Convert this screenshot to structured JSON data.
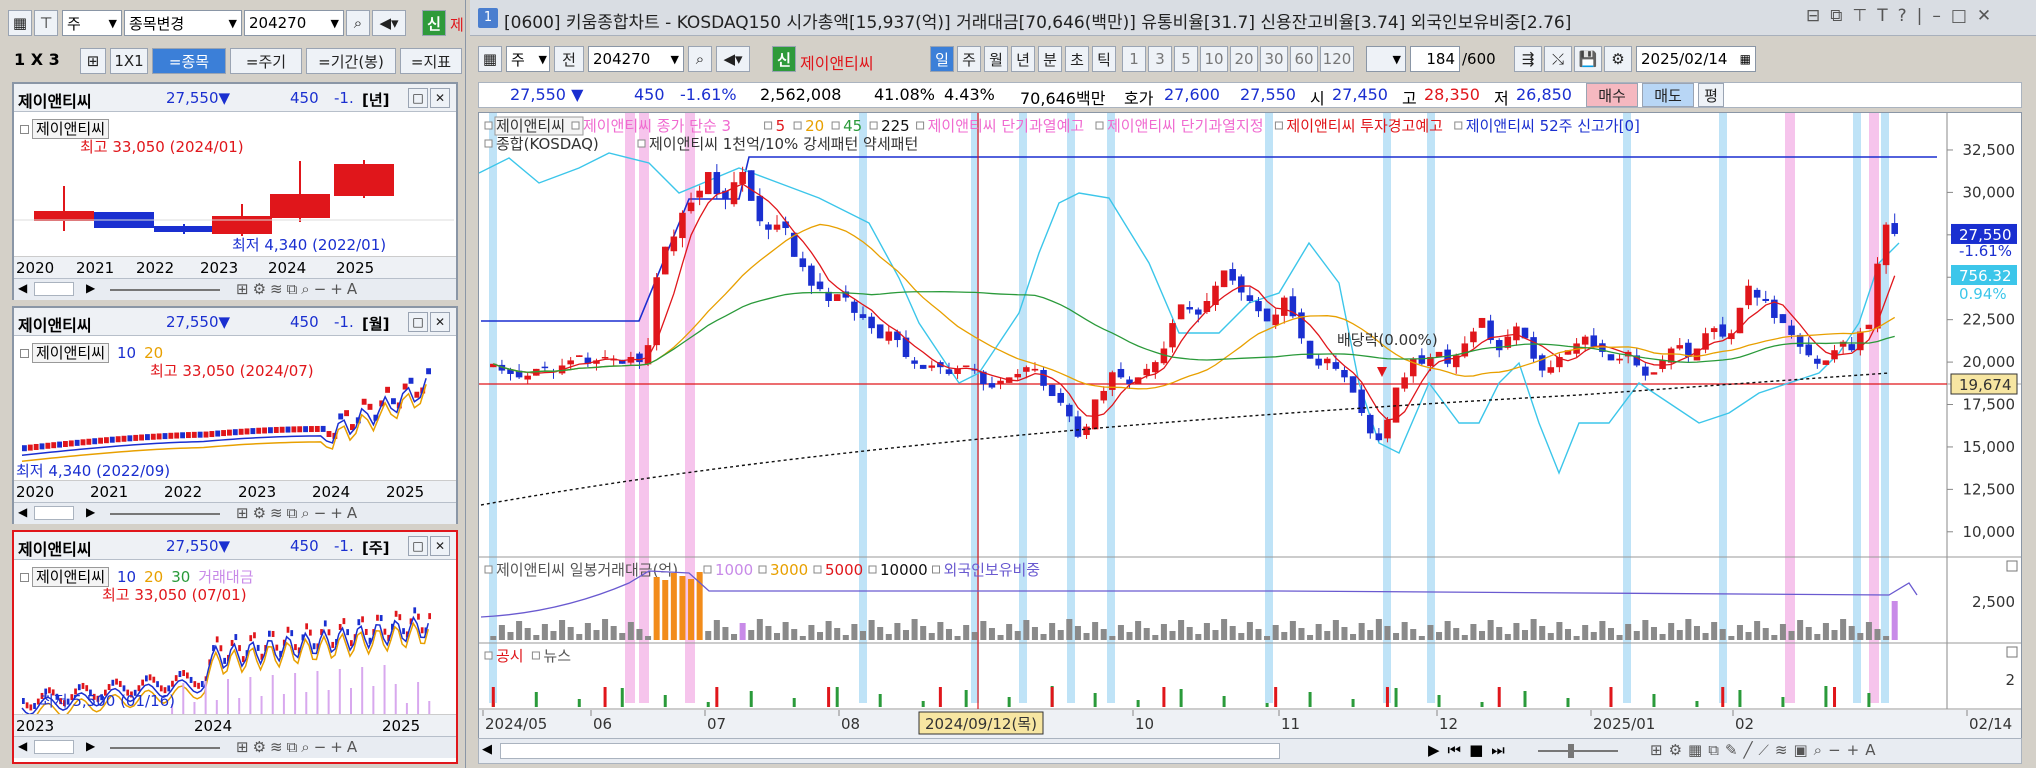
{
  "left_toolbar": {
    "stock_change": "종목변경",
    "code": "204270",
    "new_badge": "신",
    "new_name": "제",
    "prefix": "주"
  },
  "left_tabs": {
    "layout1": "1",
    "layout_x": "X",
    "layout3": "3",
    "one_by_one": "1X1",
    "stock": "=종목",
    "period": "=주기",
    "range": "=기간(봉)",
    "indicator": "=지표"
  },
  "mini_charts": [
    {
      "name": "제이앤티씨",
      "price": "27,550▼",
      "change": "450",
      "rate": "-1.",
      "period": "[년]",
      "chip": "제이앤티씨",
      "legend": [],
      "high_label": "최고 33,050 (2024/01)",
      "low_label": "최저 4,340 (2022/01)",
      "x_ticks": [
        "2020",
        "2021",
        "2022",
        "2023",
        "2024",
        "2025"
      ]
    },
    {
      "name": "제이앤티씨",
      "price": "27,550▼",
      "change": "450",
      "rate": "-1.",
      "period": "[월]",
      "chip": "제이앤티씨",
      "legend": [
        "10",
        "20"
      ],
      "high_label": "최고 33,050 (2024/07)",
      "low_label": "최저 4,340 (2022/09)",
      "x_ticks": [
        "2020",
        "2021",
        "2022",
        "2023",
        "2024",
        "2025"
      ]
    },
    {
      "name": "제이앤티씨",
      "price": "27,550▼",
      "change": "450",
      "rate": "-1.",
      "period": "[주]",
      "chip": "제이앤티씨",
      "legend": [
        "10",
        "20",
        "30",
        "거래대금"
      ],
      "high_label": "최고 33,050 (07/01)",
      "low_label": "최저 5,500 (01/16)",
      "x_ticks": [
        "2023",
        "2024",
        "2025"
      ]
    }
  ],
  "window": {
    "num": "1",
    "title": "[0600] 키움종합차트 - KOSDAQ150 시가총액[15,937(억)] 거래대금[70,646(백만)] 유통비율[31.7] 신용잔고비율[3.74] 외국인보유비중[2.76]"
  },
  "toolbar": {
    "prefix": "주",
    "prev": "전",
    "code": "204270",
    "new_badge": "신",
    "stock_name": "제이앤티씨",
    "periods": [
      "일",
      "주",
      "월",
      "년",
      "분",
      "초",
      "틱"
    ],
    "intervals": [
      "1",
      "3",
      "5",
      "10",
      "20",
      "30",
      "60",
      "120"
    ],
    "count": "184",
    "total": "/600",
    "date": "2025/02/14"
  },
  "quote": {
    "price": "27,550 ▼",
    "change": "450",
    "rate": "-1.61%",
    "volume": "2,562,008",
    "ratio1": "41.08%",
    "ratio2": "4.43%",
    "amount": "70,646백만",
    "bid_label": "호가",
    "bid": "27,600",
    "ask": "27,550",
    "open_label": "시",
    "open": "27,450",
    "high_label": "고",
    "high": "28,350",
    "low_label": "저",
    "low": "26,850",
    "buy": "매수",
    "sell": "매도",
    "eval": "평"
  },
  "main_legend": {
    "row1": [
      {
        "text": "제이앤티씨",
        "color": "#333333"
      },
      {
        "text": "제이앤티씨 종가 단순 3",
        "color": "#f06ad0"
      },
      {
        "text": "5",
        "color": "#e0161b"
      },
      {
        "text": "20",
        "color": "#e8a000"
      },
      {
        "text": "45",
        "color": "#2a9a3a"
      },
      {
        "text": "225",
        "color": "#111111"
      },
      {
        "text": "제이앤티씨 단기과열예고",
        "color": "#f06ad0"
      },
      {
        "text": "제이앤티씨 단기과열지정",
        "color": "#f06ad0"
      },
      {
        "text": "제이앤티씨 투자경고예고",
        "color": "#e0161b"
      },
      {
        "text": "제이앤티씨 52주 신고가[0]",
        "color": "#1a2fd0"
      }
    ],
    "row2": [
      {
        "text": "종합(KOSDAQ)",
        "color": "#333333"
      },
      {
        "text": "제이앤티씨 1천억/10% 강세패턴  약세패턴",
        "color": "#333333"
      }
    ]
  },
  "chart_data": {
    "type": "candlestick",
    "y_ticks": [
      "32,500",
      "30,000",
      "27,500",
      "25,000",
      "22,500",
      "20,000",
      "17,500",
      "15,000",
      "12,500",
      "10,000"
    ],
    "x_ticks": [
      "2024/05",
      "06",
      "07",
      "08",
      "2024/09/12(목)",
      "10",
      "11",
      "12",
      "2025/01",
      "02",
      "02/14"
    ],
    "price_label": "27,550",
    "rate_label": "-1.61%",
    "index_label": "756.32",
    "index_rate": "0.94%",
    "crosshair_label": "19,674",
    "dividend_label": "배당락(0.00%)",
    "closes": [
      19900,
      19500,
      19300,
      19100,
      19200,
      19600,
      19700,
      19400,
      19800,
      20100,
      20400,
      19900,
      20100,
      20300,
      20200,
      19900,
      20300,
      20000,
      21000,
      25000,
      26800,
      27400,
      28800,
      29400,
      30100,
      31200,
      29900,
      29600,
      30600,
      31200,
      29500,
      28300,
      27800,
      28100,
      27900,
      26200,
      25600,
      24500,
      24300,
      23600,
      24000,
      23800,
      22900,
      22600,
      22000,
      21400,
      21800,
      21300,
      20300,
      19900,
      19600,
      19800,
      19700,
      19300,
      19600,
      19800,
      19500,
      18700,
      18500,
      18900,
      19100,
      19300,
      19700,
      19600,
      18600,
      18000,
      17600,
      16800,
      15600,
      16200,
      17800,
      18300,
      19400,
      19100,
      18700,
      19100,
      19600,
      20000,
      20800,
      22300,
      23400,
      23100,
      22800,
      23600,
      24500,
      25400,
      24800,
      24100,
      23600,
      23000,
      22400,
      22800,
      23800,
      22700,
      21400,
      20200,
      19800,
      20200,
      19600,
      19100,
      18200,
      17000,
      15800,
      15400,
      16600,
      18500,
      19100,
      20200,
      19900,
      20300,
      20600,
      19900,
      20400,
      21100,
      21800,
      22600,
      21300,
      20700,
      21500,
      22100,
      21400,
      20200,
      19500,
      19700,
      20300,
      20700,
      21100,
      21500,
      20900,
      20600,
      20100,
      20200,
      20600,
      19800,
      19200,
      19400,
      20100,
      20800,
      21000,
      20300,
      20800,
      21700,
      22000,
      21500,
      21700,
      23200,
      24500,
      23800,
      23600,
      22600,
      22300,
      21600,
      20900,
      20400,
      19900,
      20100,
      20700,
      21200,
      20700,
      21800,
      22200,
      25800,
      28100,
      27550
    ],
    "sub_legend": [
      {
        "text": "제이앤티씨 일봉거래대금(억)",
        "color": "#555555"
      },
      {
        "text": "1000",
        "color": "#c88ae8"
      },
      {
        "text": "3000",
        "color": "#e8a000"
      },
      {
        "text": "5000",
        "color": "#e0161b"
      },
      {
        "text": "10000",
        "color": "#111111"
      },
      {
        "text": "외국인보유비중",
        "color": "#6a5ad0"
      }
    ],
    "sub_tick": "2,500",
    "news_legend": [
      {
        "text": "공시",
        "color": "#e0161b"
      },
      {
        "text": "뉴스",
        "color": "#555555"
      }
    ],
    "news_tick": "2"
  }
}
